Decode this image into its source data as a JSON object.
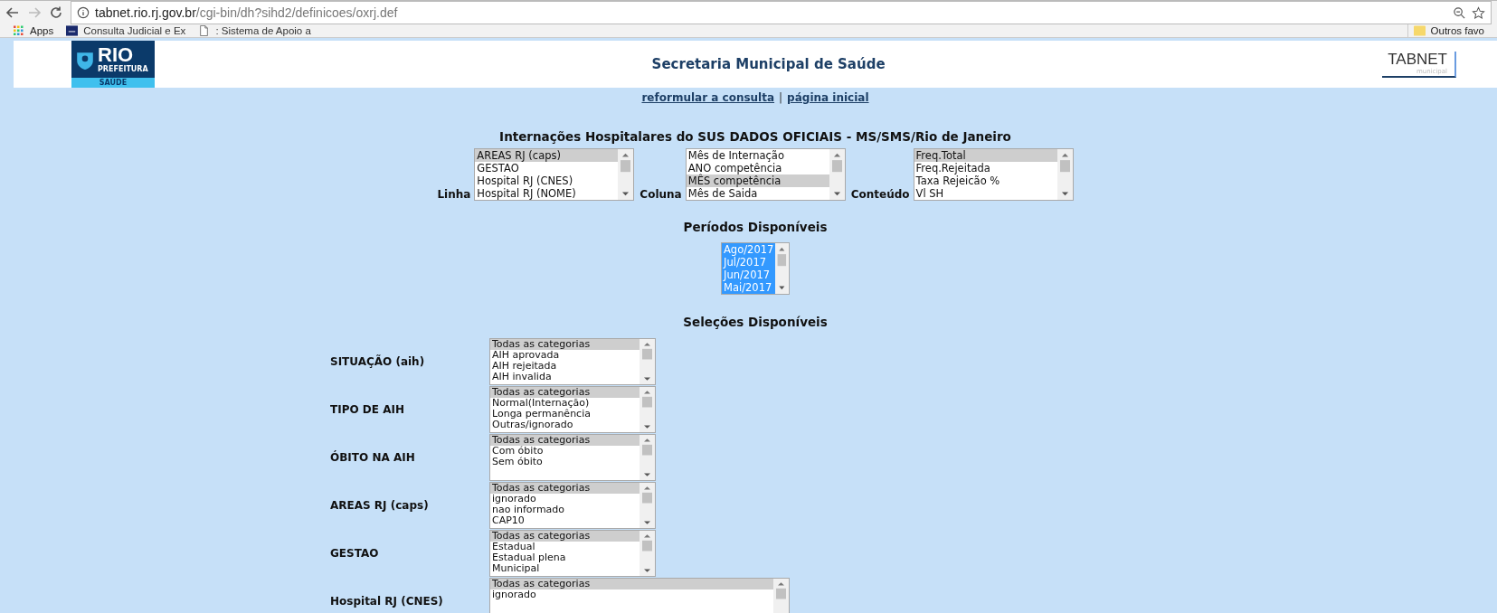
{
  "browser": {
    "url": {
      "host": "tabnet.rio.rj.gov.br",
      "path": "/cgi-bin/dh?sihd2/definicoes/oxrj.def"
    },
    "bookmarks": [
      {
        "kind": "apps",
        "label": "Apps"
      },
      {
        "kind": "site",
        "label": "Consulta Judicial e Ex"
      },
      {
        "kind": "page",
        "label": ": Sistema de Apoio a"
      }
    ],
    "other_bookmarks": "Outros favo"
  },
  "header": {
    "logo": {
      "title": "RIO",
      "subtitle": "PREFEITURA",
      "band": "SAÚDE"
    },
    "title": "Secretaria Municipal de Saúde",
    "tabnet": {
      "title": "TABNET",
      "subtitle": "municipal"
    }
  },
  "links": [
    {
      "label": "reformular a consulta"
    },
    {
      "label": "página inicial"
    }
  ],
  "separator": "|",
  "query_title": "Internações Hospitalares do SUS DADOS OFICIAIS - MS/SMS/Rio de Janeiro",
  "query_lists": [
    {
      "label": "Linha",
      "options": [
        {
          "text": "AREAS RJ (caps)",
          "selected": true
        },
        {
          "text": "GESTAO",
          "selected": false
        },
        {
          "text": "Hospital RJ (CNES)",
          "selected": false
        },
        {
          "text": "Hospital RJ (NOME)",
          "selected": false
        }
      ]
    },
    {
      "label": "Coluna",
      "options": [
        {
          "text": "Mês de Internação",
          "selected": false
        },
        {
          "text": "ANO competência",
          "selected": false
        },
        {
          "text": "MÊS competência",
          "selected": true
        },
        {
          "text": "Mês de Saida",
          "selected": false
        }
      ]
    },
    {
      "label": "Conteúdo",
      "options": [
        {
          "text": "Freq.Total",
          "selected": true
        },
        {
          "text": "Freq.Rejeitada",
          "selected": false
        },
        {
          "text": "Taxa Rejeicão %",
          "selected": false
        },
        {
          "text": "Vl SH",
          "selected": false
        }
      ]
    }
  ],
  "periods": {
    "title": "Períodos Disponíveis",
    "focused": true,
    "options": [
      {
        "text": "Ago/2017",
        "selected": true
      },
      {
        "text": "Jul/2017",
        "selected": true
      },
      {
        "text": "Jun/2017",
        "selected": true
      },
      {
        "text": "Mai/2017",
        "selected": true
      }
    ]
  },
  "selections": {
    "title": "Seleções Disponíveis",
    "rows": [
      {
        "label": "SITUAÇÃO (aih)",
        "wide": false,
        "options": [
          {
            "text": "Todas as categorias",
            "selected": true
          },
          {
            "text": "AIH aprovada",
            "selected": false
          },
          {
            "text": "AIH rejeitada",
            "selected": false
          },
          {
            "text": "AIH invalida",
            "selected": false
          }
        ]
      },
      {
        "label": "TIPO DE AIH",
        "wide": false,
        "options": [
          {
            "text": "Todas as categorias",
            "selected": true
          },
          {
            "text": "Normal(Internação)",
            "selected": false
          },
          {
            "text": "Longa permanência",
            "selected": false
          },
          {
            "text": "Outras/ignorado",
            "selected": false
          }
        ]
      },
      {
        "label": "ÓBITO NA AIH",
        "wide": false,
        "options": [
          {
            "text": "Todas as categorias",
            "selected": true
          },
          {
            "text": "Com óbito",
            "selected": false
          },
          {
            "text": "Sem óbito",
            "selected": false
          }
        ]
      },
      {
        "label": "AREAS RJ (caps)",
        "wide": false,
        "options": [
          {
            "text": "Todas as categorias",
            "selected": true
          },
          {
            "text": "ignorado",
            "selected": false
          },
          {
            "text": "nao informado",
            "selected": false
          },
          {
            "text": "CAP10",
            "selected": false
          }
        ]
      },
      {
        "label": "GESTAO",
        "wide": false,
        "options": [
          {
            "text": "Todas as categorias",
            "selected": true
          },
          {
            "text": "Estadual",
            "selected": false
          },
          {
            "text": "Estadual plena",
            "selected": false
          },
          {
            "text": "Municipal",
            "selected": false
          }
        ]
      },
      {
        "label": "Hospital RJ (CNES)",
        "wide": true,
        "options": [
          {
            "text": "Todas as categorias",
            "selected": true
          },
          {
            "text": "ignorado",
            "selected": false
          }
        ]
      }
    ]
  }
}
